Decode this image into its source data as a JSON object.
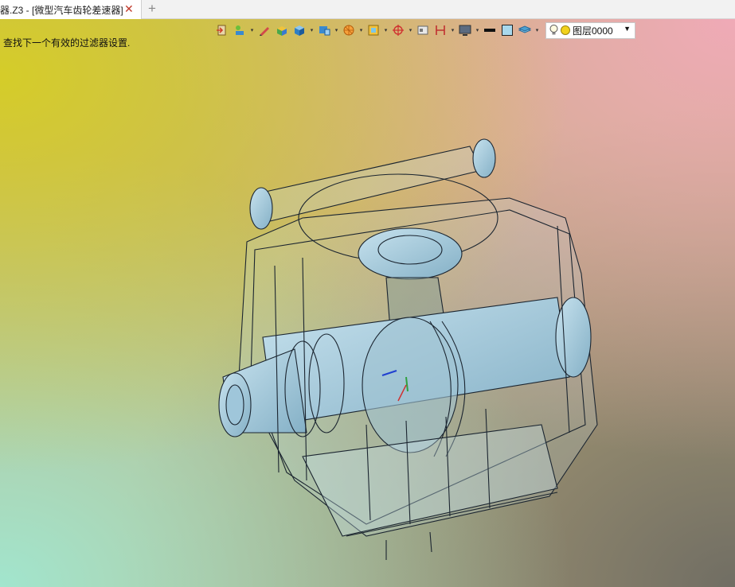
{
  "tab": {
    "title": "器.Z3 - [微型汽车齿轮差速器]",
    "close_glyph": "✕",
    "new_glyph": "+"
  },
  "status": {
    "message": "查找下一个有效的过滤器设置."
  },
  "layer": {
    "name": "图层0000",
    "bulb_icon": "lightbulb-icon",
    "color": "#f2d21c"
  },
  "toolbar_icons": [
    "exit-icon",
    "display-filter-icon",
    "pen-icon",
    "shaded-box-icon",
    "cube-icon",
    "view-cube-icon",
    "render-icon",
    "frame-icon",
    "target-icon",
    "window-icon",
    "dimension-icon",
    "monitor-icon",
    "line-color-icon",
    "fill-color-icon",
    "layers-icon"
  ],
  "colors": {
    "tab_close": "#c0392b",
    "model_blue": "#9fc6da"
  }
}
